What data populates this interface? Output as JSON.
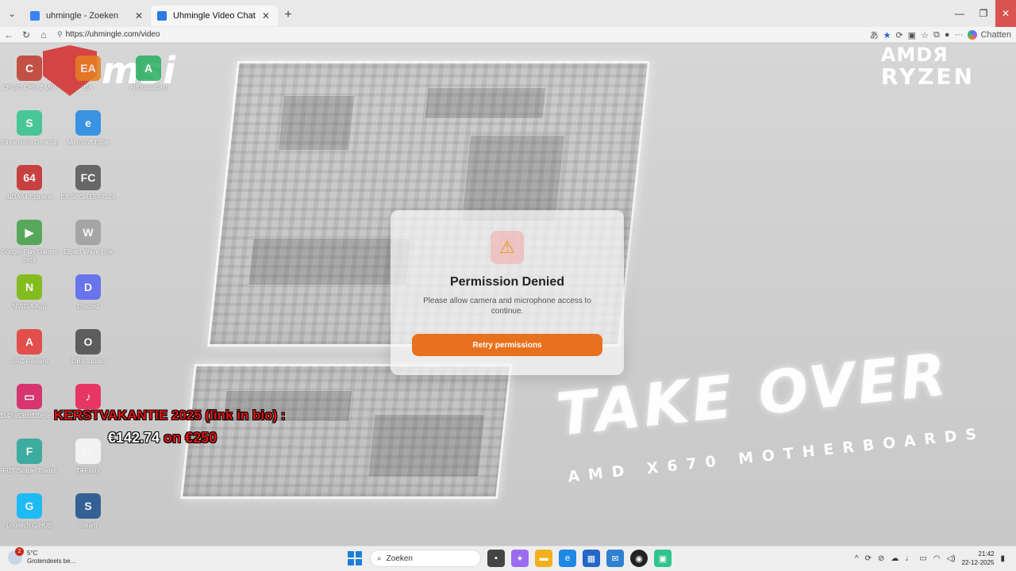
{
  "browser": {
    "tabs": [
      {
        "title": "uhmingle - Zoeken",
        "active": false,
        "favicon_color": "#3b82f6"
      },
      {
        "title": "Uhmingle Video Chat",
        "active": true,
        "favicon_color": "#2a7ae2"
      }
    ],
    "new_tab_symbol": "+",
    "url": "https://uhmingle.com/video",
    "chatten_label": "Chatten"
  },
  "wallpaper": {
    "brand": "msi",
    "amd_line1": "AMDЯ",
    "amd_line2": "RYZEN",
    "takeover": "TAKE OVER",
    "subtitle": "AMD X670 MOTHERBOARDS"
  },
  "desktop_icons": [
    {
      "label": "CPUID CPU-Z MSI",
      "color": "#c0392b",
      "glyph": "C"
    },
    {
      "label": "EA",
      "color": "#e67e22",
      "glyph": "EA"
    },
    {
      "label": "AirDroid Cast",
      "color": "#27ae60",
      "glyph": "A"
    },
    {
      "label": "Streamlabs Desktop",
      "color": "#31c48d",
      "glyph": "S"
    },
    {
      "label": "Microsoft Edge",
      "color": "#1e88e5",
      "glyph": "e"
    },
    {
      "label": "AIDA64 Extreme",
      "color": "#c62828",
      "glyph": "64"
    },
    {
      "label": "EA SPORTS FC 26",
      "color": "#555555",
      "glyph": "FC"
    },
    {
      "label": "Google Play Games beta",
      "color": "#43a047",
      "glyph": "▶"
    },
    {
      "label": "Elgato Wave Link",
      "color": "#9e9e9e",
      "glyph": "W"
    },
    {
      "label": "NVIDIA App",
      "color": "#76b900",
      "glyph": "N"
    },
    {
      "label": "Discord",
      "color": "#5865f2",
      "glyph": "D"
    },
    {
      "label": "ARC Raiders",
      "color": "#e53935",
      "glyph": "A"
    },
    {
      "label": "OBS Studio",
      "color": "#4a4a4a",
      "glyph": "O"
    },
    {
      "label": "1147a530df01e9e9...",
      "color": "#d81b60",
      "glyph": "▭"
    },
    {
      "label": "TikTok",
      "color": "#ee1d52",
      "glyph": "♪"
    },
    {
      "label": "FUT Simple Trader",
      "color": "#26a69a",
      "glyph": "F"
    },
    {
      "label": "TikFinity",
      "color": "#fafafa",
      "glyph": "TF"
    },
    {
      "label": "Logitech G HUB",
      "color": "#00b8fc",
      "glyph": "G"
    },
    {
      "label": "Steam",
      "color": "#1b4f8a",
      "glyph": "S"
    }
  ],
  "promo": {
    "line1": "KERSTVAKANTIE 2025 (link in bio) :",
    "price_now": "€142.74",
    "on": "on",
    "price_target": "€250"
  },
  "dialog": {
    "warning_glyph": "⚠",
    "title": "Permission Denied",
    "message": "Please allow camera and microphone access to continue.",
    "button": "Retry permissions",
    "button_color": "#e8711e"
  },
  "taskbar": {
    "weather_badge": "2",
    "temperature": "5°C",
    "condition": "Grotendeels be...",
    "search_placeholder": "Zoeken",
    "time": "21:42",
    "date": "22-12-2025"
  }
}
